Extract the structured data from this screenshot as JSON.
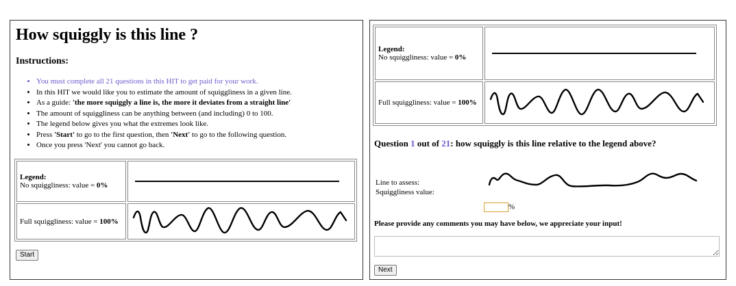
{
  "left": {
    "title": "How squiggly is this line ?",
    "instructions_heading": "Instructions:",
    "instructions": [
      "You must complete all 21 questions in this HIT to get paid for your work.",
      "In this HIT we would like you to estimate the amount of squiggliness in a given line.",
      "As a guide: ",
      "The amount of squiggliness can be anything between (and including) 0 to 100.",
      "The legend below gives you what the extremes look like.",
      "Press ",
      "Once you press 'Next' you cannot go back."
    ],
    "guide_bold": "'the more squiggly a line is, the more it deviates from a straight line'",
    "press_start": "'Start'",
    "press_middle": " to go to the first question, then ",
    "press_next": "'Next'",
    "press_end": " to go to the following question.",
    "start_label": "Start"
  },
  "legend": {
    "heading": "Legend:",
    "no_label": "No squiggliness: value = ",
    "no_value": "0%",
    "full_label": "Full squiggliness: value = ",
    "full_value": "100%"
  },
  "right": {
    "question_prefix": "Question ",
    "question_number": "1",
    "question_middle": " out of ",
    "question_total": "21",
    "question_suffix": ": how squiggly is this line relative to the legend above?",
    "line_to_assess_label": "Line to assess:",
    "squiggliness_value_label": "Squiggliness value:",
    "value_input": "",
    "percent_sign": "%",
    "comments_label": "Please provide any comments you may have below, we appreciate your input!",
    "comments_value": "",
    "next_label": "Next"
  },
  "colors": {
    "accent": "#6a5acd",
    "input_border": "#d9a030"
  }
}
